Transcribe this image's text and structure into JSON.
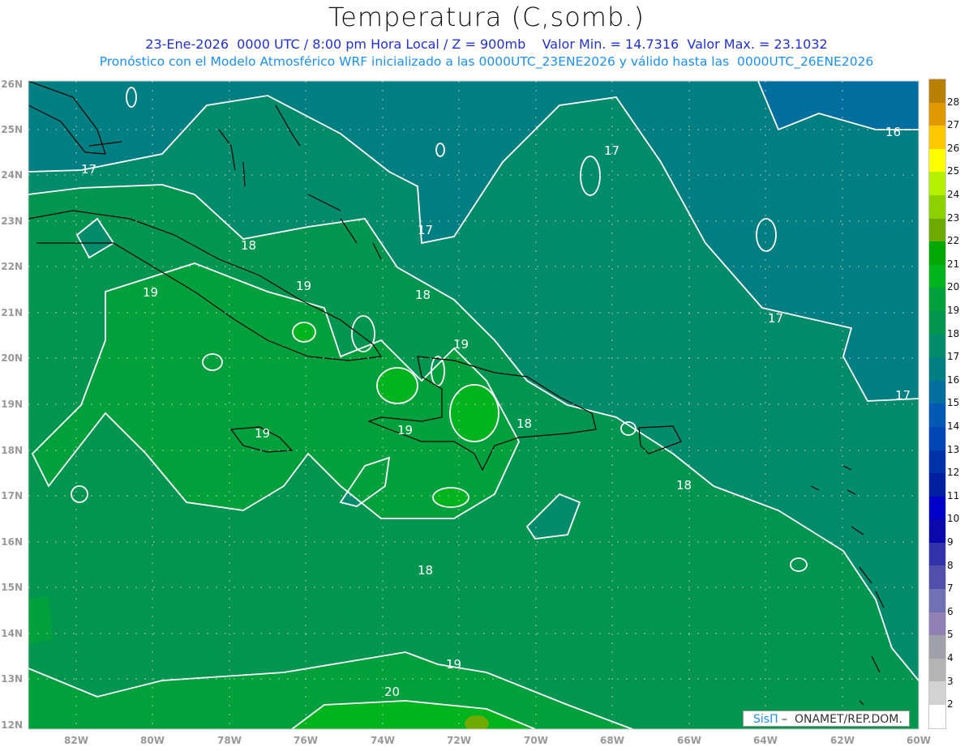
{
  "header": {
    "title": "Temperatura (C,somb.)",
    "line1": "23-Ene-2026  0000 UTC / 8:00 pm Hora Local / Z = 900mb    Valor Min. = 14.7316  Valor Max. = 23.1032",
    "line2": "Pronóstico con el Modelo Atmosférico WRF inicializado a las 0000UTC_23ENE2026 y válido hasta las  0000UTC_26ENE2026"
  },
  "axes": {
    "lon_labels": [
      "82W",
      "80W",
      "78W",
      "76W",
      "74W",
      "72W",
      "70W",
      "68W",
      "66W",
      "64W",
      "62W",
      "60W"
    ],
    "lat_labels": [
      "26N",
      "25N",
      "24N",
      "23N",
      "22N",
      "21N",
      "20N",
      "19N",
      "18N",
      "17N",
      "16N",
      "15N",
      "14N",
      "13N",
      "12N"
    ]
  },
  "contour_labels": [
    "17",
    "17",
    "17",
    "17",
    "17",
    "16",
    "18",
    "18",
    "18",
    "18",
    "18",
    "19",
    "19",
    "19",
    "19",
    "19",
    "19",
    "20"
  ],
  "colorbar": {
    "labels": [
      "28",
      "27",
      "26",
      "25",
      "24",
      "23",
      "22",
      "21",
      "20",
      "19",
      "18",
      "17",
      "16",
      "15",
      "14",
      "13",
      "12",
      "11",
      "10",
      "9",
      "8",
      "7",
      "6",
      "5",
      "4",
      "3",
      "2"
    ],
    "colors": [
      "#b97f00",
      "#e09a00",
      "#ffc800",
      "#ffff00",
      "#b4f000",
      "#8cd200",
      "#6eaa00",
      "#00a800",
      "#00b41e",
      "#00a03c",
      "#00964f",
      "#008b6b",
      "#007f82",
      "#006fa0",
      "#005ab4",
      "#0046b4",
      "#0032aa",
      "#001ea0",
      "#0000c8",
      "#0a0aaa",
      "#3232aa",
      "#5050aa",
      "#7070b4",
      "#9080b4",
      "#a0a0aa",
      "#b4b4b4",
      "#d2d2d2",
      "#ffffff"
    ]
  },
  "credit": {
    "brand": "SisΠ",
    "text": " –  ONAMET/REP.DOM."
  }
}
